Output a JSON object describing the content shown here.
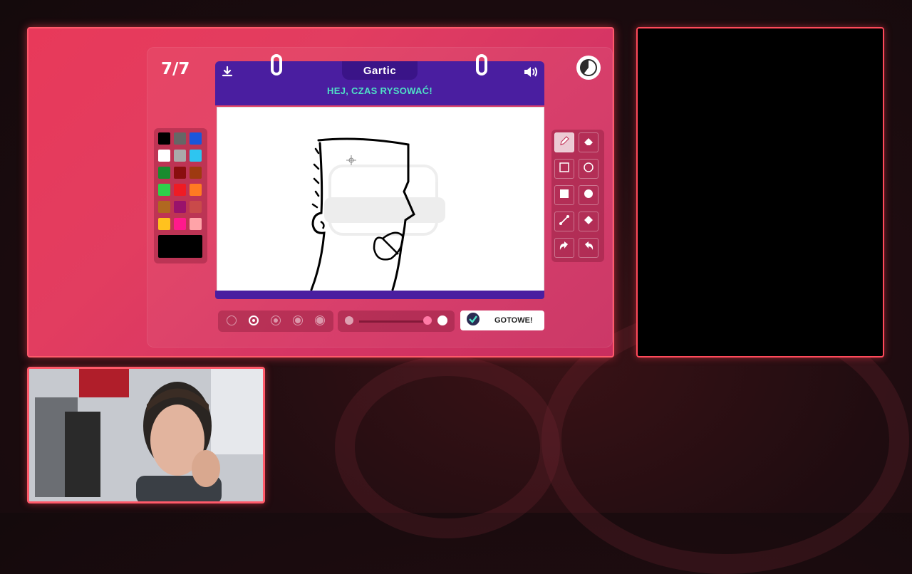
{
  "game": {
    "round": "7/7",
    "logo": "Gartic",
    "prompt": "HEJ, CZAS RYSOWAĆ!",
    "done_label": "GOTOWE!"
  },
  "palette": {
    "colors": [
      "#000000",
      "#666666",
      "#1a56db",
      "#ffffff",
      "#aaaaaa",
      "#2ec5f0",
      "#1a8c2e",
      "#8a0e0e",
      "#9e3a10",
      "#2ed14a",
      "#ee1c24",
      "#ff7a22",
      "#b06820",
      "#99126b",
      "#c94a4a",
      "#ffc21e",
      "#ff1a8c",
      "#ffa3a8"
    ],
    "current_color": "#000000"
  },
  "tools": [
    {
      "name": "pencil-tool",
      "icon": "pencil-icon",
      "active": true
    },
    {
      "name": "eraser-tool",
      "icon": "eraser-icon",
      "active": false
    },
    {
      "name": "rectangle-tool",
      "icon": "square-outline-icon",
      "active": false
    },
    {
      "name": "ellipse-tool",
      "icon": "circle-outline-icon",
      "active": false
    },
    {
      "name": "filled-rectangle-tool",
      "icon": "square-filled-icon",
      "active": false
    },
    {
      "name": "filled-ellipse-tool",
      "icon": "circle-filled-icon",
      "active": false
    },
    {
      "name": "line-tool",
      "icon": "line-icon",
      "active": false
    },
    {
      "name": "fill-tool",
      "icon": "bucket-icon",
      "active": false
    },
    {
      "name": "undo-tool",
      "icon": "undo-icon",
      "active": false
    },
    {
      "name": "redo-tool",
      "icon": "redo-icon",
      "active": false
    }
  ],
  "colors": {
    "accent": "#ff5a6a",
    "book": "#4a1ea0",
    "prompt": "#4fe0c6"
  }
}
